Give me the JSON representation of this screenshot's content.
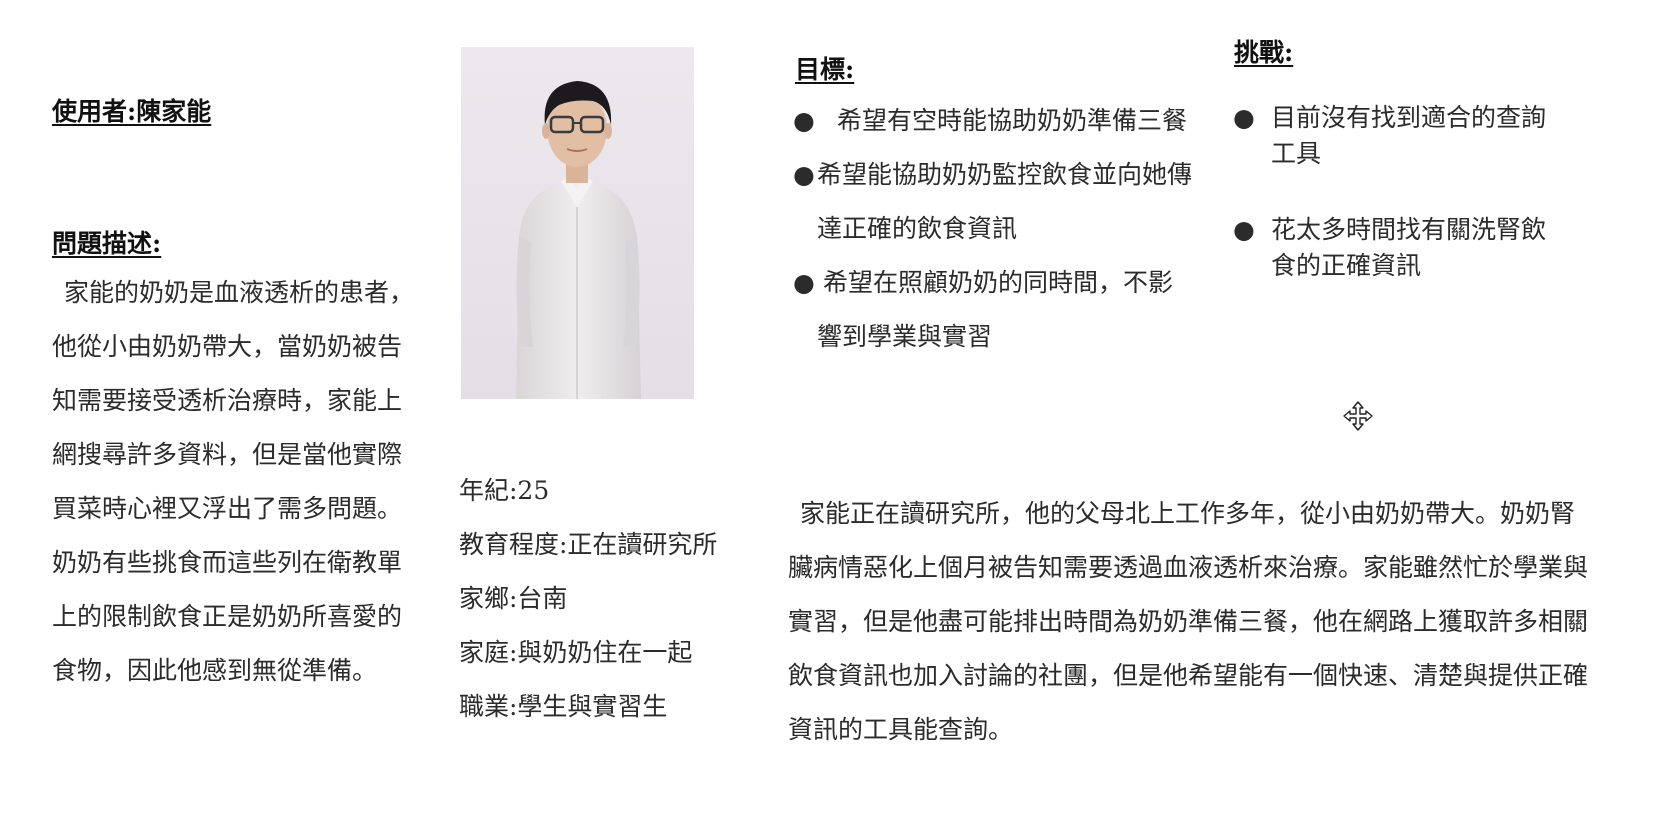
{
  "user": {
    "heading": "使用者:陳家能"
  },
  "problem": {
    "heading": "問題描述:",
    "description": "家能的奶奶是血液透析的患者，他從小由奶奶帶大，當奶奶被告知需要接受透析治療時，家能上網搜尋許多資料，但是當他實際買菜時心裡又浮出了需多問題。奶奶有些挑食而這些列在衛教單上的限制飲食正是奶奶所喜愛的食物，因此他感到無從準備。"
  },
  "profile": {
    "age": "年紀:25",
    "education": "教育程度:正在讀研究所",
    "hometown": "家鄉:台南",
    "family": "家庭:與奶奶住在一起",
    "occupation": "職業:學生與實習生"
  },
  "goals": {
    "heading": "目標:",
    "items": [
      "希望有空時能協助奶奶準備三餐",
      "希望能協助奶奶監控飲食並向她傳達正確的飲食資訊",
      "希望在照顧奶奶的同時間，不影響到學業與實習"
    ]
  },
  "challenges": {
    "heading": "挑戰:",
    "items": [
      "目前沒有找到適合的查詢工具",
      "花太多時間找有關洗腎飲食的正確資訊"
    ]
  },
  "story": "家能正在讀研究所，他的父母北上工作多年，從小由奶奶帶大。奶奶腎臟病情惡化上個月被告知需要透過血液透析來治療。家能雖然忙於學業與實習，但是他盡可能排出時間為奶奶準備三餐，他在網路上獲取許多相關飲食資訊也加入討論的社團，但是他希望能有一個快速、清楚與提供正確資訊的工具能查詢。",
  "bullet": "●",
  "icons": {
    "cursor": "move-cursor-icon"
  }
}
